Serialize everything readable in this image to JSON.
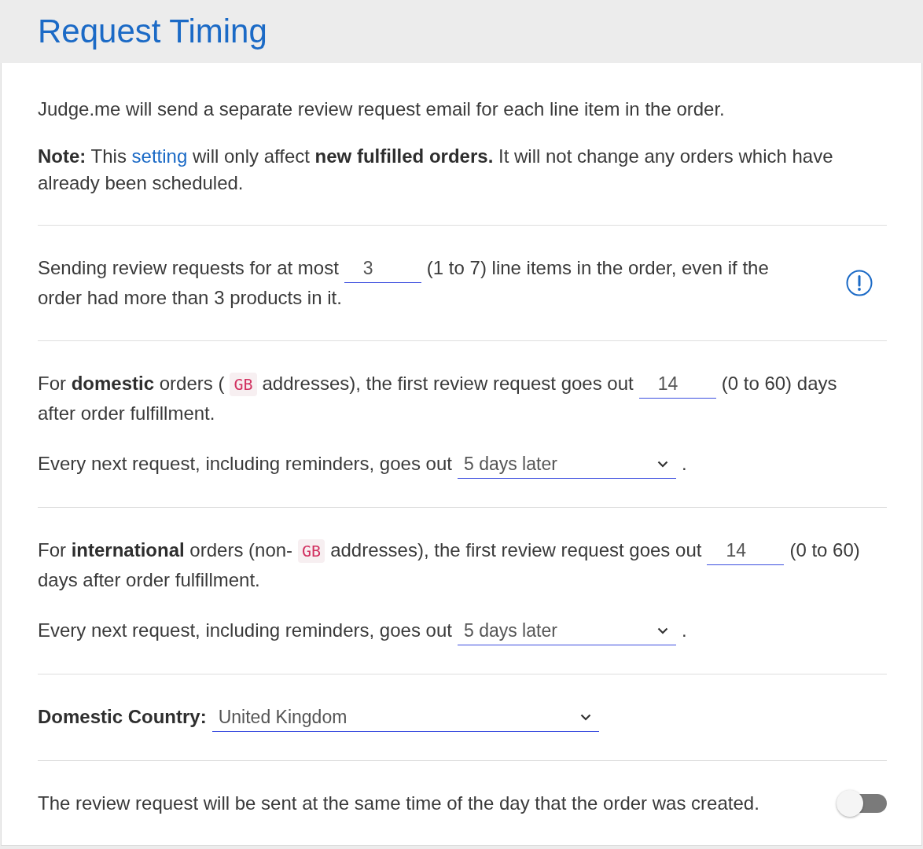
{
  "header": {
    "title": "Request Timing"
  },
  "intro": "Judge.me will send a separate review request email for each line item in the order.",
  "note": {
    "before": "**Note:** This",
    "link": "setting",
    "after": "will only affect **new fulfilled orders.** It will not change any orders which have already been scheduled."
  },
  "sections": [
    {
      "side": {
        "kind": "info"
      },
      "paragraphs": [
        {
          "lines": [
            [
              {
                "kind": "text",
                "text": "Sending review requests for at most"
              },
              {
                "kind": "number_field",
                "value": "3"
              },
              {
                "kind": "text",
                "text": "(1 to 7) line items in the order, even if the"
              }
            ],
            [
              {
                "kind": "text",
                "text": "order had more than 3 products in it."
              }
            ]
          ]
        }
      ]
    },
    {
      "paragraphs": [
        {
          "lines": [
            [
              {
                "kind": "text",
                "text": "For **domestic** orders ("
              },
              {
                "kind": "code",
                "text": "GB"
              },
              {
                "kind": "text",
                "text": "addresses), the first review request goes out"
              },
              {
                "kind": "number_field",
                "value": "14"
              },
              {
                "kind": "text",
                "text": "(0 to 60) days"
              }
            ],
            [
              {
                "kind": "text",
                "text": "after order fulfillment."
              }
            ]
          ]
        },
        {
          "lines": [
            [
              {
                "kind": "text",
                "text": "Every next request, including reminders, goes out"
              },
              {
                "kind": "select",
                "value": "5 days later"
              },
              {
                "kind": "text",
                "text": "."
              }
            ]
          ]
        }
      ]
    },
    {
      "paragraphs": [
        {
          "lines": [
            [
              {
                "kind": "text",
                "text": "For **international** orders (non-"
              },
              {
                "kind": "code",
                "text": "GB"
              },
              {
                "kind": "text",
                "text": "addresses), the first review request goes out"
              },
              {
                "kind": "number_field",
                "value": "14"
              },
              {
                "kind": "text",
                "text": "(0 to 60)"
              }
            ],
            [
              {
                "kind": "text",
                "text": "days after order fulfillment."
              }
            ]
          ]
        },
        {
          "lines": [
            [
              {
                "kind": "text",
                "text": "Every next request, including reminders, goes out"
              },
              {
                "kind": "select",
                "value": "5 days later"
              },
              {
                "kind": "text",
                "text": "."
              }
            ]
          ]
        }
      ]
    },
    {
      "paragraphs": [
        {
          "lines": [
            [
              {
                "kind": "label",
                "text": "Domestic Country:"
              },
              {
                "kind": "select",
                "value": "United Kingdom"
              }
            ]
          ]
        }
      ]
    },
    {
      "side": {
        "kind": "switch",
        "on": false
      },
      "paragraphs": [
        {
          "lines": [
            [
              {
                "kind": "text",
                "text": "The review request will be sent at the same time of the day that the order was created."
              }
            ]
          ]
        }
      ]
    }
  ]
}
